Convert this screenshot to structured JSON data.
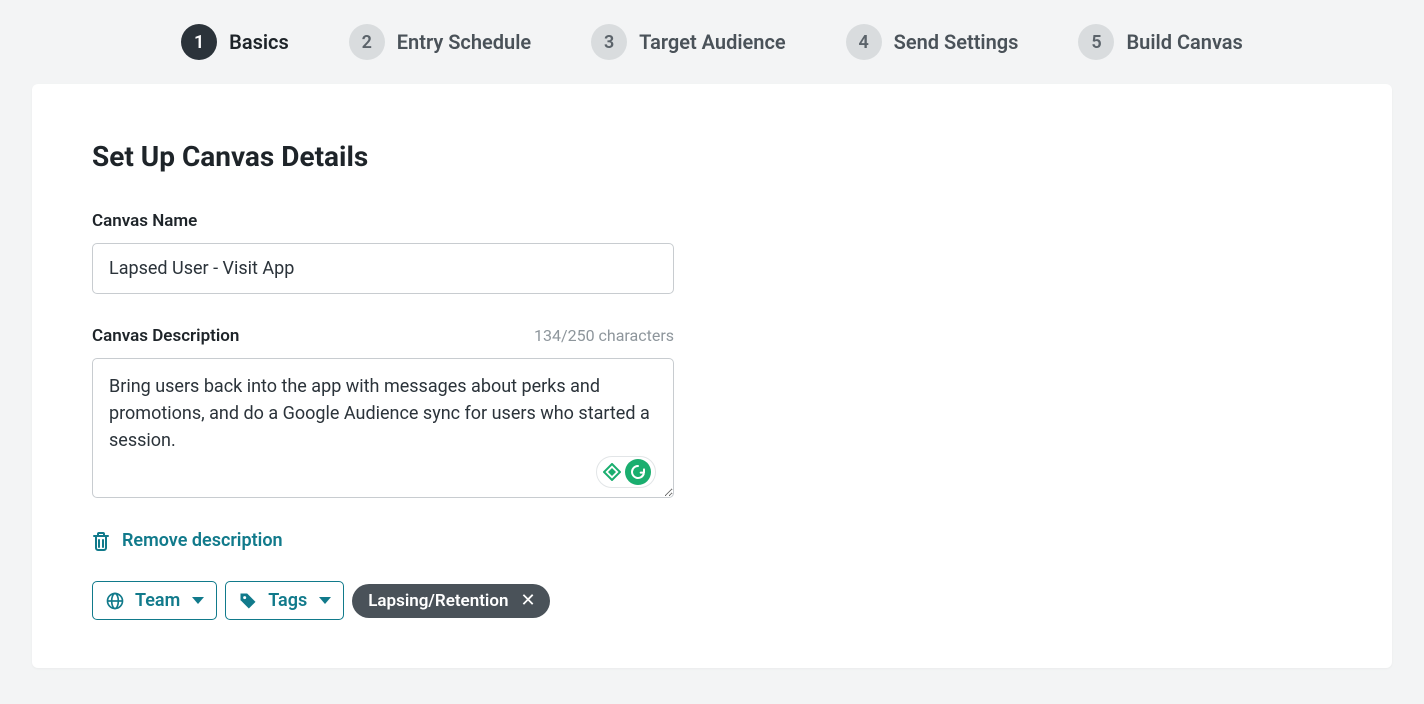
{
  "stepper": {
    "steps": [
      {
        "num": "1",
        "label": "Basics",
        "active": true
      },
      {
        "num": "2",
        "label": "Entry Schedule",
        "active": false
      },
      {
        "num": "3",
        "label": "Target Audience",
        "active": false
      },
      {
        "num": "4",
        "label": "Send Settings",
        "active": false
      },
      {
        "num": "5",
        "label": "Build Canvas",
        "active": false
      }
    ]
  },
  "page": {
    "title": "Set Up Canvas Details"
  },
  "canvas_name": {
    "label": "Canvas Name",
    "value": "Lapsed User - Visit App"
  },
  "canvas_description": {
    "label": "Canvas Description",
    "char_count": "134/250 characters",
    "value": "Bring users back into the app with messages about perks and promotions, and do a Google Audience sync for users who started a session."
  },
  "remove_description_label": "Remove description",
  "chips": {
    "team_label": "Team",
    "tags_label": "Tags"
  },
  "tags": [
    {
      "label": "Lapsing/Retention"
    }
  ],
  "colors": {
    "teal": "#117a8b",
    "step_active_bg": "#2b333a",
    "step_inactive_bg": "#d9dcde",
    "chip_solid_bg": "#4a5259"
  }
}
